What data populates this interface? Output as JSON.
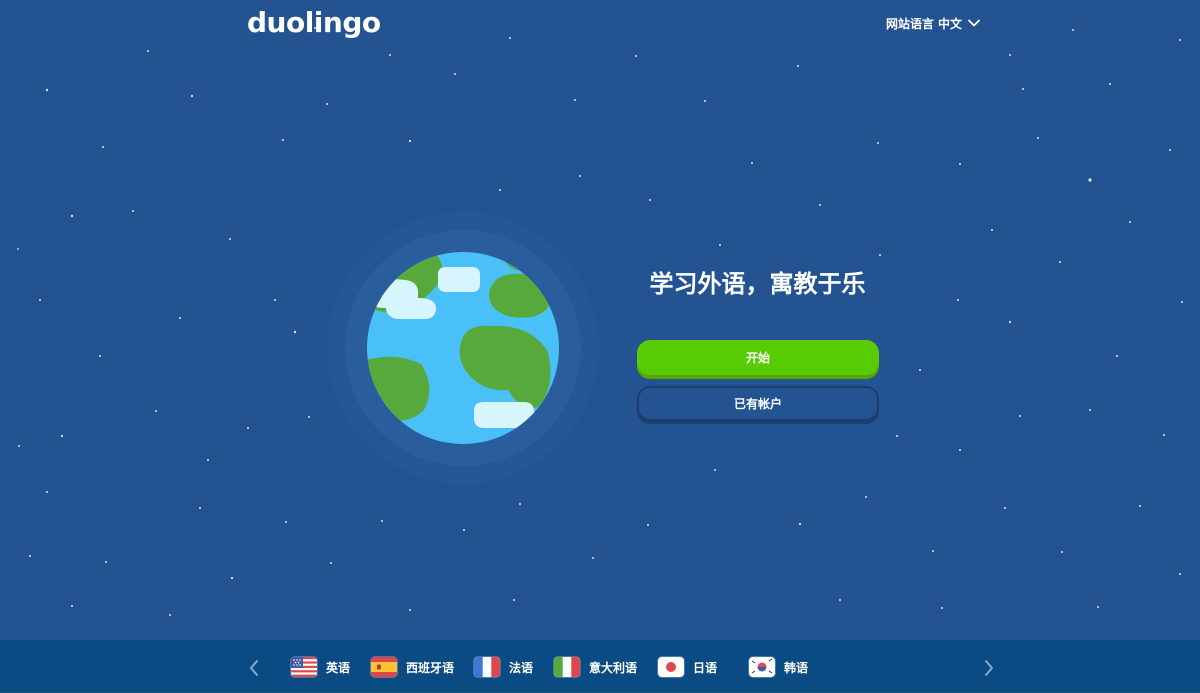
{
  "header": {
    "logo": "duolingo",
    "site_language_label": "网站语言",
    "site_language_value": "中文"
  },
  "hero": {
    "headline": "学习外语，寓教于乐",
    "primary_button": "开始",
    "secondary_button": "已有帐户"
  },
  "language_bar": {
    "languages": [
      {
        "label": "英语",
        "flag": "us-flag-icon"
      },
      {
        "label": "西班牙语",
        "flag": "spain-flag-icon"
      },
      {
        "label": "法语",
        "flag": "france-flag-icon"
      },
      {
        "label": "意大利语",
        "flag": "italy-flag-icon"
      },
      {
        "label": "日语",
        "flag": "japan-flag-icon"
      },
      {
        "label": "韩语",
        "flag": "korea-flag-icon"
      }
    ]
  },
  "colors": {
    "background": "#235390",
    "primary_green": "#58cc02",
    "ocean_blue": "#49c0f8",
    "land_green": "#58a93c",
    "cloud": "#d7f5fd",
    "language_bar": "#0b4b84"
  }
}
